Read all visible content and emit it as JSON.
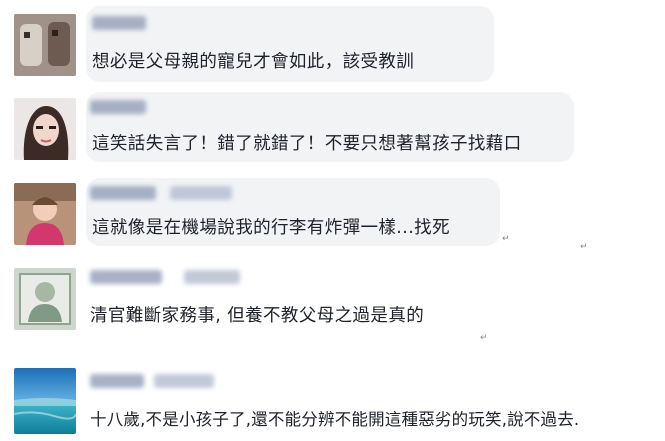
{
  "comments": [
    {
      "text": "想必是父母親的寵兒才會如此，該受教訓"
    },
    {
      "text": "這笑話失言了！錯了就錯了！不要只想著幫孩子找藉口"
    },
    {
      "text": "這就像是在機場說我的行李有炸彈一樣...找死"
    },
    {
      "text": "清官難斷家務事, 但養不教父母之過是真的"
    },
    {
      "text": "十八歲,不是小孩子了,還不能分辨不能開這種惡劣的玩笑,說不過去."
    }
  ],
  "paragraph_mark": "↵",
  "colors": {
    "bubble": "#f2f3f5",
    "name_blur": "#9aa4bc",
    "text": "#1d2129"
  },
  "icons": [
    "avatar-1",
    "avatar-2",
    "avatar-3",
    "avatar-4",
    "avatar-5-ocean"
  ]
}
